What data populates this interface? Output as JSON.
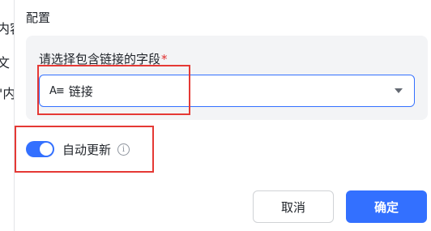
{
  "left_panel": {
    "fragments": [
      "内容",
      "文",
      "\"内"
    ]
  },
  "config": {
    "section_title": "配置",
    "field_label": "请选择包含链接的字段",
    "required_mark": "*",
    "select": {
      "type_icon": "A≡",
      "value": "链接"
    },
    "auto_update": {
      "label": "自动更新",
      "enabled": true,
      "info_icon": "info-icon"
    }
  },
  "actions": {
    "cancel_label": "取消",
    "confirm_label": "确定"
  },
  "colors": {
    "accent": "#3370ff",
    "highlight": "#e53935",
    "card_bg": "#f3f4f6"
  }
}
